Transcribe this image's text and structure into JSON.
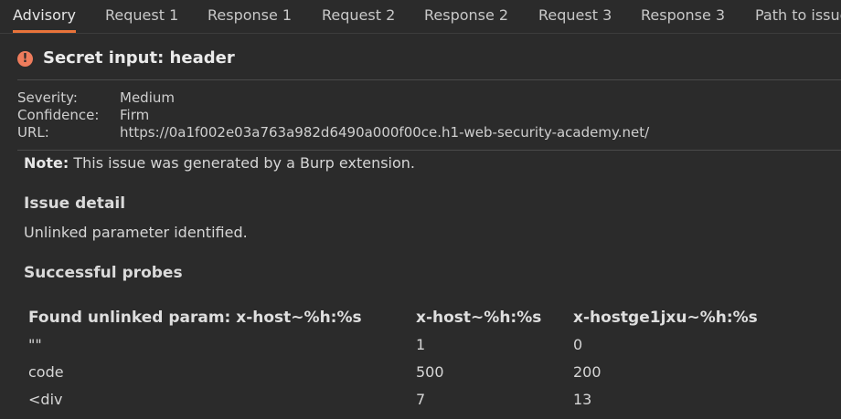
{
  "tabs": [
    {
      "label": "Advisory",
      "active": true
    },
    {
      "label": "Request 1"
    },
    {
      "label": "Response 1"
    },
    {
      "label": "Request 2"
    },
    {
      "label": "Response 2"
    },
    {
      "label": "Request 3"
    },
    {
      "label": "Response 3"
    },
    {
      "label": "Path to issue"
    }
  ],
  "issue": {
    "icon": "!",
    "title": "Secret input: header"
  },
  "meta": {
    "severity_label": "Severity:",
    "severity_value": "Medium",
    "confidence_label": "Confidence:",
    "confidence_value": "Firm",
    "url_label": "URL:",
    "url_value": "https://0a1f002e03a763a982d6490a000f00ce.h1-web-security-academy.net/"
  },
  "note": {
    "label": "Note:",
    "text": " This issue was generated by a Burp extension."
  },
  "detail": {
    "heading": "Issue detail",
    "text": "Unlinked parameter identified."
  },
  "probes": {
    "heading": "Successful probes",
    "columns": [
      "Found unlinked param: x-host~%h:%s",
      "x-host~%h:%s",
      "x-hostge1jxu~%h:%s"
    ],
    "rows": [
      [
        "\"\"",
        "1",
        "0"
      ],
      [
        "code",
        "500",
        "200"
      ],
      [
        "<div",
        "7",
        "13"
      ]
    ]
  },
  "colors": {
    "accent": "#e8733a",
    "warning": "#ee7c5c",
    "background": "#2b2b2b"
  }
}
